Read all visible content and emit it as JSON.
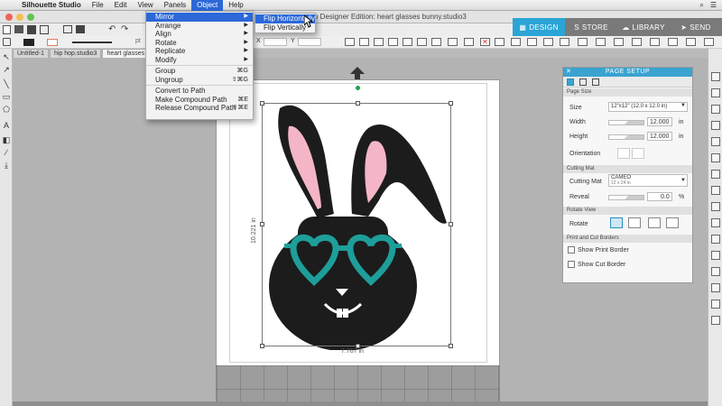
{
  "menubar": {
    "app_name": "Silhouette Studio",
    "items": [
      "File",
      "Edit",
      "View",
      "Panels",
      "Object",
      "Help"
    ],
    "active_item": "Object"
  },
  "window": {
    "title": "Silhouette Studio® Designer Edition: heart glasses bunny.studio3",
    "title_visible": "o Designer Edition: heart glasses bunny.studio3"
  },
  "top_tabs": [
    {
      "label": "DESIGN",
      "active": true
    },
    {
      "label": "STORE",
      "active": false
    },
    {
      "label": "LIBRARY",
      "active": false
    },
    {
      "label": "SEND",
      "active": false
    }
  ],
  "toolbar": {
    "unit": "pt",
    "x_label": "X",
    "y_label": "Y"
  },
  "doc_tabs": [
    "Untitled-1",
    "hip hop.studio3",
    "heart glasses b"
  ],
  "object_menu": {
    "items": [
      {
        "label": "Mirror",
        "submenu": true,
        "highlighted": true
      },
      {
        "label": "Arrange",
        "submenu": true
      },
      {
        "label": "Align",
        "submenu": true
      },
      {
        "label": "Rotate",
        "submenu": true
      },
      {
        "label": "Replicate",
        "submenu": true
      },
      {
        "label": "Modify",
        "submenu": true
      },
      {
        "label": "Group",
        "shortcut": "⌘G"
      },
      {
        "label": "Ungroup",
        "shortcut": "⇧⌘G"
      },
      {
        "label": "Convert to Path"
      },
      {
        "label": "Make Compound Path",
        "shortcut": "⌘E"
      },
      {
        "label": "Release Compound Path",
        "shortcut": "⇧⌘E"
      }
    ]
  },
  "mirror_submenu": {
    "items": [
      {
        "label": "Flip Horizontally",
        "highlighted": true
      },
      {
        "label": "Flip Vertically",
        "highlighted": false
      }
    ]
  },
  "selection": {
    "width": "7.767 in",
    "height": "10.221 in"
  },
  "page_setup": {
    "title": "PAGE SETUP",
    "page_size_section": "Page Size",
    "size_label": "Size",
    "size_value": "12\"x12\" (12.0 x 12.0 in)",
    "width_label": "Width",
    "width_value": "12.000",
    "height_label": "Height",
    "height_value": "12.000",
    "unit": "in",
    "orientation_label": "Orientation",
    "cutting_mat_section": "Cutting Mat",
    "cutting_mat_label": "Cutting Mat",
    "cutting_mat_name": "CAMEO",
    "cutting_mat_size": "12 x 24 in",
    "reveal_label": "Reveal",
    "reveal_value": "0.0",
    "reveal_unit": "%",
    "rotate_view_section": "Rotate View",
    "rotate_label": "Rotate",
    "borders_section": "Print and Cut Borders",
    "show_print_border": "Show Print Border",
    "show_cut_border": "Show Cut Border"
  },
  "colors": {
    "accent": "#2aa5d6",
    "highlight": "#2c68d8",
    "bunny": "#1c1c1c",
    "ears": "#f4b6c6",
    "glasses": "#1e9e9a",
    "green_dot": "#1aa34a"
  }
}
